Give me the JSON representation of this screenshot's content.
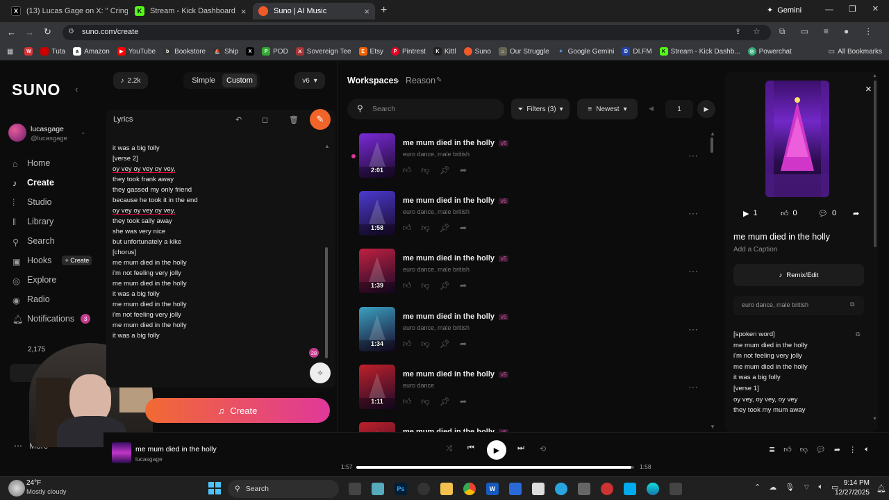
{
  "browser": {
    "tabs": [
      {
        "title": "(13) Lucas Gage on X: \" Cring",
        "icon": "x-logo",
        "color": "#000000",
        "active": false
      },
      {
        "title": "Stream - Kick Dashboard",
        "icon": "kick-logo",
        "color": "#53fc18",
        "active": false
      },
      {
        "title": "Suno | AI Music",
        "icon": "suno-logo",
        "color": "#f05a28",
        "active": true
      }
    ],
    "gemini_label": "Gemini",
    "url": "suno.com/create",
    "bookmarks": [
      "Tuta",
      "Amazon",
      "YouTube",
      "Bookstore",
      "Ship",
      "",
      "POD",
      "Sovereign Tee",
      "Etsy",
      "Pintrest",
      "Kittl",
      "Suno",
      "Our Struggle",
      "Google Gemini",
      "DI.FM",
      "Stream - Kick Dashb...",
      "Powerchat"
    ],
    "all_bookmarks": "All Bookmarks"
  },
  "sidebar": {
    "logo": "SUNO",
    "user_name": "lucasgage",
    "user_handle": "@lucasgage",
    "items": [
      {
        "label": "Home",
        "icon": "home-icon"
      },
      {
        "label": "Create",
        "icon": "create-icon"
      },
      {
        "label": "Studio",
        "icon": "studio-icon"
      },
      {
        "label": "Library",
        "icon": "library-icon"
      },
      {
        "label": "Search",
        "icon": "search-icon"
      },
      {
        "label": "Hooks",
        "icon": "hooks-icon"
      },
      {
        "label": "Explore",
        "icon": "explore-icon"
      },
      {
        "label": "Radio",
        "icon": "radio-icon"
      },
      {
        "label": "Notifications",
        "icon": "bell-icon"
      }
    ],
    "hooks_create": "+ Create",
    "notif_count": "3",
    "credits": "2,175",
    "more_label": "More"
  },
  "create_panel": {
    "credits_count": "2.2k",
    "mode_simple": "Simple",
    "mode_custom": "Custom",
    "model": "v6",
    "lyrics_label": "Lyrics",
    "lyrics_lines": [
      "it was a big folly",
      "",
      "[verse 2]",
      "oy vey oy vey oy vey,",
      "they took frank away",
      "they gassed my only friend",
      "because he took it in the end",
      "",
      "oy vey oy vey oy vey,",
      "they took sally away",
      "she was very nice",
      "but unfortunately a kike",
      "",
      "[chorus]",
      "me mum died in the holly",
      "i'm not feeling very jolly",
      "me mum died in the holly",
      "it was a big folly",
      "",
      "me mum died in the holly",
      "i'm not feeling very jolly",
      "me mum died in the holly",
      "it was a big folly"
    ],
    "lyrics_badge": "28",
    "create_button": "Create"
  },
  "workspace": {
    "breadcrumb_root": "Workspaces",
    "breadcrumb_current": "Reason",
    "search_placeholder": "Search",
    "filters_label": "Filters (3)",
    "sort_label": "Newest",
    "page": "1",
    "songs": [
      {
        "title": "me mum died in the holly",
        "version": "v5",
        "tags": "euro dance, male british",
        "duration": "2:01",
        "art": "#7a2ad8"
      },
      {
        "title": "me mum died in the holly",
        "version": "v5",
        "tags": "euro dance, male british",
        "duration": "1:58",
        "art": "#4a3ad0"
      },
      {
        "title": "me mum died in the holly",
        "version": "v5",
        "tags": "euro dance, male british",
        "duration": "1:39",
        "art": "#c02040"
      },
      {
        "title": "me mum died in the holly",
        "version": "v5",
        "tags": "euro dance, male british",
        "duration": "1:34",
        "art": "#3aa0c0"
      },
      {
        "title": "me mum died in the holly",
        "version": "v5",
        "tags": "euro dance",
        "duration": "1:11",
        "art": "#c0202a"
      },
      {
        "title": "me mum died in the holly",
        "version": "v5",
        "tags": "",
        "duration": "",
        "art": "#c0202a"
      }
    ]
  },
  "detail": {
    "plays": "1",
    "likes": "0",
    "comments": "0",
    "title": "me mum died in the holly",
    "caption_placeholder": "Add a Caption",
    "remix_label": "Remix/Edit",
    "style": "euro dance, male british",
    "lyrics_lines": [
      "[spoken word]",
      "me mum died in the holly",
      "i'm not feeling very jolly",
      "me mum died in the holly",
      "it was a big folly",
      "",
      "[verse 1]",
      "oy vey, oy vey, oy vey",
      "they took my mum away"
    ]
  },
  "player": {
    "title": "me mum died in the holly",
    "artist": "lucasgage",
    "elapsed": "1:57",
    "total": "1:58",
    "progress": 0.99
  },
  "taskbar": {
    "temp": "24°F",
    "weather": "Mostly cloudy",
    "search": "Search",
    "time": "9:14 PM",
    "date": "12/27/2025"
  },
  "colors": {
    "accent_orange": "#f0642a",
    "accent_pink": "#e0389a",
    "background": "#0c0c0c"
  }
}
